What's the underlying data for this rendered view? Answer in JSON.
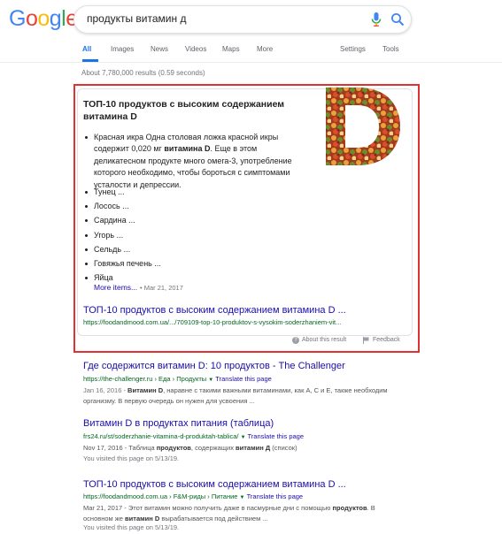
{
  "logo": {
    "text": "Google"
  },
  "search": {
    "query": "продукты витамин д"
  },
  "tabs": [
    {
      "label": "All"
    },
    {
      "label": "Images"
    },
    {
      "label": "News"
    },
    {
      "label": "Videos"
    },
    {
      "label": "Maps"
    },
    {
      "label": "More"
    },
    {
      "label": "Settings"
    },
    {
      "label": "Tools"
    }
  ],
  "stats": "About 7,780,000 results (0.59 seconds)",
  "snippet": {
    "title": "ТОП-10 продуктов с высоким содержанием витамина D",
    "first_bullet": [
      "Красная икра Одна столовая ложка красной икры содержит 0,020 мг ",
      "витамина D",
      ". Еще в этом деликатесном продукте много омега-3, употребление которого необходимо, чтобы бороться с симптомами усталости и депрессии."
    ],
    "items": [
      "Тунец ...",
      "Лосось ...",
      "Сардина ...",
      "Угорь ...",
      "Сельдь ...",
      "Говяжья печень ...",
      "Яйца"
    ],
    "more": "More items...",
    "date": "• Mar 21, 2017",
    "link": "ТОП-10 продуктов с высоким содержанием витамина D ...",
    "url": "https://foodandmood.com.ua/.../709109-top-10-produktov-s-vysokim-soderzhaniem-vit...",
    "about": "About this result",
    "feedback": "Feedback"
  },
  "results": [
    {
      "title": "Где содержится витамин D: 10 продуктов - The Challenger",
      "url": "https://the-challenger.ru › Еда › Продукты",
      "translate": "Translate this page",
      "snippet": [
        "Jan 16, 2016 - ",
        "Витамин D",
        ", наравне с такими важными витаминами, как А, С и Е, также необходим организму. В первую очередь он нужен для усвоения ..."
      ]
    },
    {
      "title": "Витамин D в продуктах питания (таблица)",
      "url": "frs24.ru/st/soderzhanie-vitamina-d-produktah-tablica/",
      "translate": "Translate this page",
      "snippet": [
        "Nov 17, 2016 - Таблица ",
        "продуктов",
        ", содержащих ",
        "витамин Д",
        " (список)"
      ],
      "visited": "You visited this page on 5/13/19."
    },
    {
      "title": "ТОП-10 продуктов с высоким содержанием витамина D ...",
      "url": "https://foodandmood.com.ua › F&M-риды › Питание",
      "translate": "Translate this page",
      "snippet": [
        "Mar 21, 2017 - Этот витамин можно получить даже в пасмурные дни с помощью ",
        "продуктов",
        ". В основном же ",
        "витамин D",
        " вырабатывается под действием ..."
      ],
      "visited": "You visited this page on 5/13/19."
    }
  ],
  "colors": {
    "link": "#1a0dab",
    "url": "#006621",
    "accent": "#1a73e8",
    "highlight_border": "#e23131"
  }
}
